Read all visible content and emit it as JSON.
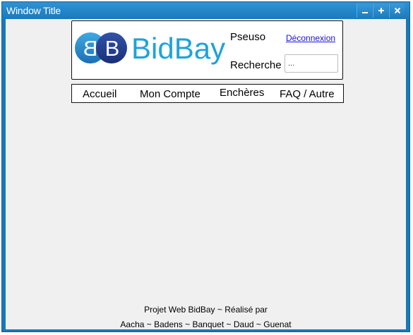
{
  "window": {
    "title": "Window Title",
    "controls": [
      "minimize-icon",
      "maximize-icon",
      "close-icon"
    ],
    "accent_color": "#1a78b8"
  },
  "header": {
    "logo_monogram": "BB",
    "logo_text": "BidBay",
    "pseudo_label": "Pseuso",
    "logout_link": "Déconnexion",
    "search_label": "Recherche",
    "search_value": "...",
    "logo_color": "#1fa3d9"
  },
  "nav": {
    "items": [
      "Accueil",
      "Mon Compte",
      "Enchères",
      "FAQ / Autre"
    ]
  },
  "footer": {
    "line1": "Projet Web BidBay ~ Réalisé par",
    "line2": "Aacha ~ Badens ~ Banquet ~ Daud ~ Guenat"
  }
}
